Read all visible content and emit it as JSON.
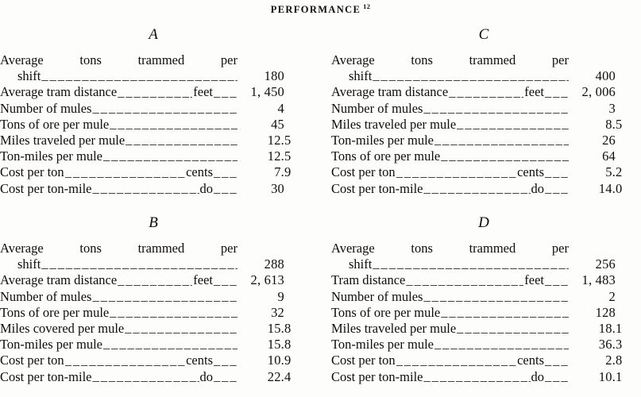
{
  "title": {
    "text": "PERFORMANCE",
    "footnote_marker": "12"
  },
  "blocks": [
    {
      "id": "A",
      "label": "A",
      "position": "top-left",
      "rows": [
        {
          "label": "Average  tons  trammed  per",
          "label_cont": "shift",
          "unit": "",
          "value_int": "180",
          "value_frac": ""
        },
        {
          "label": "Average tram distance",
          "unit": "feet",
          "value_int": "1, 450",
          "value_frac": ""
        },
        {
          "label": "Number of mules",
          "unit": "",
          "value_int": "4",
          "value_frac": ""
        },
        {
          "label": "Tons of ore per mule",
          "unit": "",
          "value_int": "45",
          "value_frac": ""
        },
        {
          "label": "Miles traveled per mule",
          "unit": "",
          "value_int": "12.",
          "value_frac": "5"
        },
        {
          "label": "Ton-miles per mule",
          "unit": "",
          "value_int": "12.",
          "value_frac": "5"
        },
        {
          "label": "Cost per ton",
          "unit": "cents",
          "value_int": "7.",
          "value_frac": "9"
        },
        {
          "label": "Cost per ton-mile",
          "unit": "do",
          "value_int": "30",
          "value_frac": ""
        }
      ]
    },
    {
      "id": "C",
      "label": "C",
      "position": "top-right",
      "rows": [
        {
          "label": "Average  tons  trammed  per",
          "label_cont": "shift",
          "unit": "",
          "value_int": "400",
          "value_frac": ""
        },
        {
          "label": "Average tram distance",
          "unit": "feet",
          "value_int": "2, 006",
          "value_frac": ""
        },
        {
          "label": "Number of mules",
          "unit": "",
          "value_int": "3",
          "value_frac": ""
        },
        {
          "label": "Miles traveled per mule",
          "unit": "",
          "value_int": "8.",
          "value_frac": "5"
        },
        {
          "label": "Ton-miles per mule",
          "unit": "",
          "value_int": "26",
          "value_frac": ""
        },
        {
          "label": "Tons of ore per mule",
          "unit": "",
          "value_int": "64",
          "value_frac": ""
        },
        {
          "label": "Cost per ton",
          "unit": "cents",
          "value_int": "5.",
          "value_frac": "2"
        },
        {
          "label": "Cost per ton-mile",
          "unit": "do",
          "value_int": "14.",
          "value_frac": "0"
        }
      ]
    },
    {
      "id": "B",
      "label": "B",
      "position": "bottom-left",
      "rows": [
        {
          "label": "Average  tons  trammed  per",
          "label_cont": "shift",
          "unit": "",
          "value_int": "288",
          "value_frac": ""
        },
        {
          "label": "Average tram distance",
          "unit": "feet",
          "value_int": "2, 613",
          "value_frac": ""
        },
        {
          "label": "Number of mules",
          "unit": "",
          "value_int": "9",
          "value_frac": ""
        },
        {
          "label": "Tons of ore per mule",
          "unit": "",
          "value_int": "32",
          "value_frac": ""
        },
        {
          "label": "Miles covered per mule",
          "unit": "",
          "value_int": "15.",
          "value_frac": "8"
        },
        {
          "label": "Ton-miles per mule",
          "unit": "",
          "value_int": "15.",
          "value_frac": "8"
        },
        {
          "label": "Cost per ton",
          "unit": "cents",
          "value_int": "10.",
          "value_frac": "9"
        },
        {
          "label": "Cost per ton-mile",
          "unit": "do",
          "value_int": "22.",
          "value_frac": "4"
        }
      ]
    },
    {
      "id": "D",
      "label": "D",
      "position": "bottom-right",
      "rows": [
        {
          "label": "Average  tons  trammed  per",
          "label_cont": "shift",
          "unit": "",
          "value_int": "256",
          "value_frac": ""
        },
        {
          "label": "Tram distance",
          "unit": "feet",
          "value_int": "1, 483",
          "value_frac": ""
        },
        {
          "label": "Number of mules",
          "unit": "",
          "value_int": "2",
          "value_frac": ""
        },
        {
          "label": "Tons of ore per mule",
          "unit": "",
          "value_int": "128",
          "value_frac": ""
        },
        {
          "label": "Miles traveled per mule",
          "unit": "",
          "value_int": "18.",
          "value_frac": "1"
        },
        {
          "label": "Ton-miles per mule",
          "unit": "",
          "value_int": "36.",
          "value_frac": "3"
        },
        {
          "label": "Cost per ton",
          "unit": "cents",
          "value_int": "2.",
          "value_frac": "8"
        },
        {
          "label": "Cost per ton-mile",
          "unit": "do",
          "value_int": "10.",
          "value_frac": "1"
        }
      ]
    }
  ]
}
